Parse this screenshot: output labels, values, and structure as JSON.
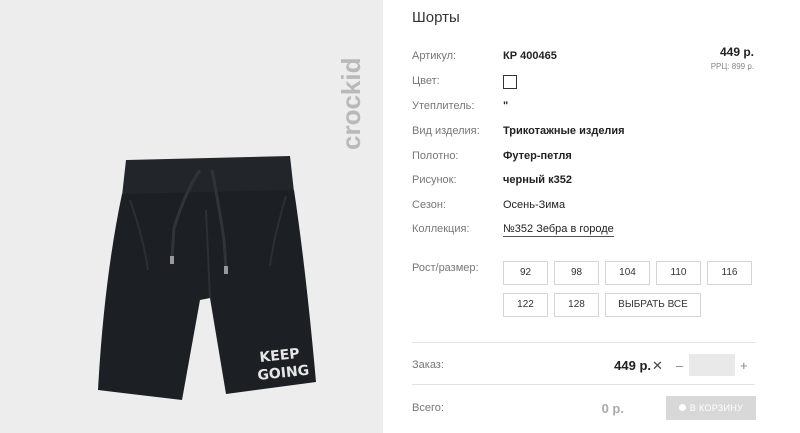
{
  "product": {
    "title": "Шорты",
    "price": "449 р.",
    "rrp": "РРЦ: 899 р."
  },
  "brand": {
    "logo_text": "crockid"
  },
  "print_text": {
    "line1": "KEEP",
    "line2": "GOING"
  },
  "details": [
    {
      "label": "Артикул:",
      "value": "КР 400465"
    },
    {
      "label": "Цвет:",
      "value": ""
    },
    {
      "label": "Утеплитель:",
      "value": "\""
    },
    {
      "label": "Вид изделия:",
      "value": "Трикотажные изделия"
    },
    {
      "label": "Полотно:",
      "value": "Футер-петля"
    },
    {
      "label": "Рисунок:",
      "value": "черный к352"
    },
    {
      "label": "Сезон:",
      "value": "Осень-Зима"
    },
    {
      "label": "Коллекция:",
      "value": "№352 Зебра в городе"
    }
  ],
  "sizes": {
    "label": "Рост/размер:",
    "options": [
      "92",
      "98",
      "104",
      "110",
      "116",
      "122",
      "128"
    ],
    "select_all": "ВЫБРАТЬ ВСЕ"
  },
  "order": {
    "label": "Заказ:",
    "price": "449 р.",
    "times": "✕",
    "minus": "–",
    "plus": "+",
    "quantity": ""
  },
  "total": {
    "label": "Всего:",
    "value": "0 р.",
    "cart_button": "В КОРЗИНУ"
  },
  "colors": {
    "photo_bg": "#ededed",
    "garment": "#1f2226",
    "cart_button": "#d8d8d8"
  }
}
